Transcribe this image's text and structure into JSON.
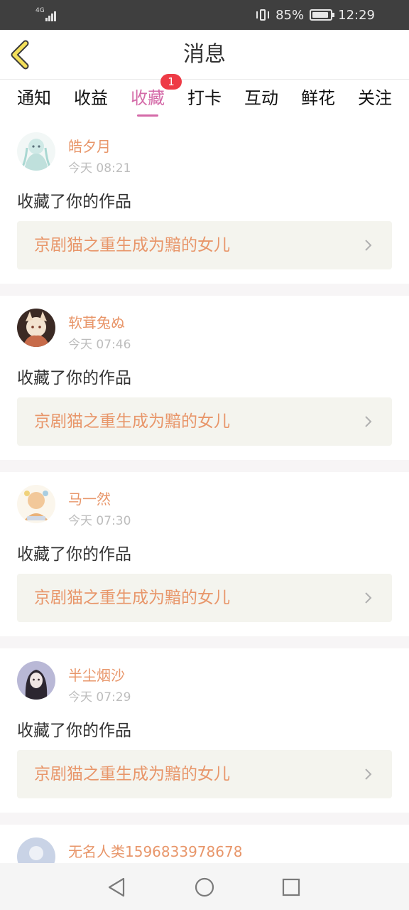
{
  "status_bar": {
    "network": "4G",
    "battery_percent": "85%",
    "time": "12:29"
  },
  "header": {
    "title": "消息",
    "back_icon": "chevron-left-icon"
  },
  "tabs": [
    {
      "label": "通知",
      "active": false
    },
    {
      "label": "收益",
      "active": false
    },
    {
      "label": "收藏",
      "active": true,
      "badge": "1"
    },
    {
      "label": "打卡",
      "active": false
    },
    {
      "label": "互动",
      "active": false
    },
    {
      "label": "鲜花",
      "active": false
    },
    {
      "label": "关注",
      "active": false
    }
  ],
  "feed": [
    {
      "username": "皓夕月",
      "time": "今天 08:21",
      "action": "收藏了你的作品",
      "work_title": "京剧猫之重生成为黯的女儿"
    },
    {
      "username": "软茸兔ぬ",
      "time": "今天 07:46",
      "action": "收藏了你的作品",
      "work_title": "京剧猫之重生成为黯的女儿"
    },
    {
      "username": "马一然",
      "time": "今天 07:30",
      "action": "收藏了你的作品",
      "work_title": "京剧猫之重生成为黯的女儿"
    },
    {
      "username": "半尘烟沙",
      "time": "今天 07:29",
      "action": "收藏了你的作品",
      "work_title": "京剧猫之重生成为黯的女儿"
    },
    {
      "username": "无名人类1596833978678"
    }
  ],
  "colors": {
    "accent_pink": "#d46aa8",
    "username_orange": "#e8966a",
    "badge_red": "#ee3b46",
    "card_bg": "#f4f4ee"
  }
}
